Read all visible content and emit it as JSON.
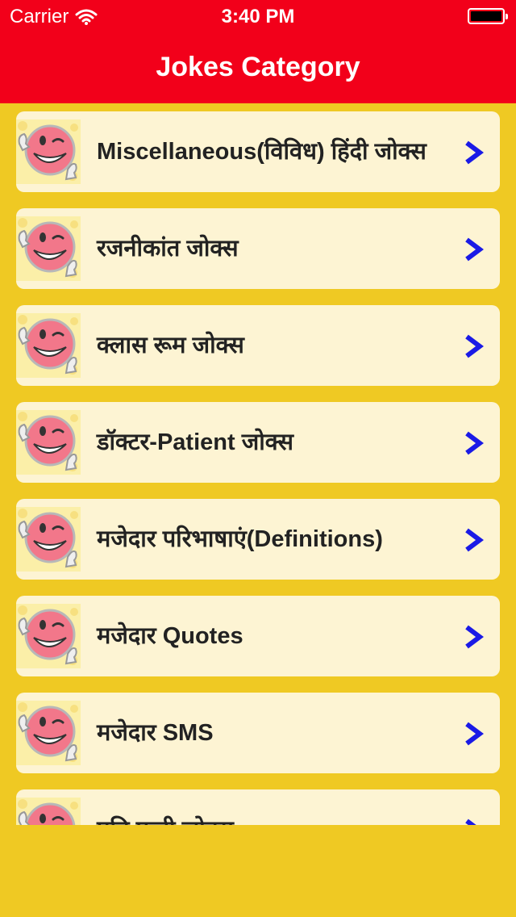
{
  "status_bar": {
    "carrier": "Carrier",
    "time": "3:40 PM"
  },
  "nav": {
    "title": "Jokes Category"
  },
  "colors": {
    "header": "#F2001A",
    "background": "#EFC923",
    "row": "#FDF4D3",
    "chevron": "#1A1AE6"
  },
  "icons": {
    "row_thumbnail": "smiley-thumbs-up-icon",
    "row_disclosure": "chevron-right-icon"
  },
  "categories": [
    {
      "label": "Miscellaneous(विविध) हिंदी जोक्स"
    },
    {
      "label": "रजनीकांत जोक्स"
    },
    {
      "label": "क्लास रूम जोक्स"
    },
    {
      "label": "डॉक्टर-Patient जोक्स"
    },
    {
      "label": "मजेदार परिभाषाएं(Definitions)"
    },
    {
      "label": "मजेदार Quotes"
    },
    {
      "label": "मजेदार SMS"
    },
    {
      "label": "पति पत्नी जोक्स"
    }
  ]
}
